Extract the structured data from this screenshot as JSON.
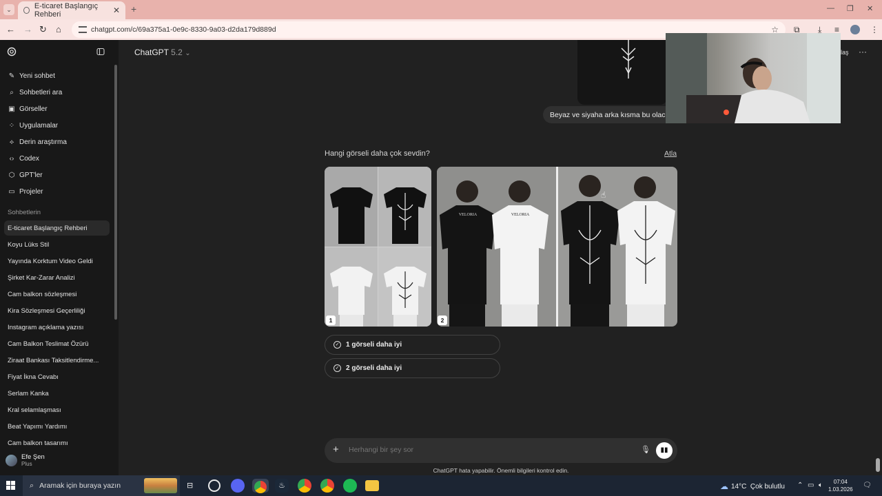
{
  "browser": {
    "tab_title": "E-ticaret Başlangıç Rehberi",
    "tab_close": "✕",
    "new_tab": "+",
    "url": "chatgpt.com/c/69a375a1-0e9c-8330-9a03-d2da179d889d"
  },
  "sidebar": {
    "nav": [
      {
        "label": "Yeni sohbet",
        "icon": "edit-icon"
      },
      {
        "label": "Sohbetleri ara",
        "icon": "search-icon"
      },
      {
        "label": "Görseller",
        "icon": "image-icon"
      },
      {
        "label": "Uygulamalar",
        "icon": "apps-icon"
      },
      {
        "label": "Derin araştırma",
        "icon": "telescope-icon"
      },
      {
        "label": "Codex",
        "icon": "code-icon"
      },
      {
        "label": "GPT'ler",
        "icon": "cube-icon"
      },
      {
        "label": "Projeler",
        "icon": "folder-icon"
      }
    ],
    "section_title": "Sohbetlerin",
    "chats": [
      "E-ticaret Başlangıç Rehberi",
      "Koyu Lüks Stil",
      "Yayında Korktum Video Geldi",
      "Şirket Kar-Zarar Analizi",
      "Cam balkon sözleşmesi",
      "Kira Sözleşmesi Geçerliliği",
      "Instagram açıklama yazısı",
      "Cam Balkon Teslimat Özürü",
      "Ziraat Bankası Taksitlendirme...",
      "Fiyat İkna Cevabı",
      "Serlam Kanka",
      "Kral selamlaşması",
      "Beat Yapımı Yardımı",
      "Cam balkon tasarımı"
    ],
    "active_chat_index": 0,
    "user": {
      "name": "Efe Şen",
      "plan": "Plus"
    }
  },
  "header": {
    "model_name": "ChatGPT",
    "model_version": "5.2",
    "share_partial": "laş"
  },
  "conversation": {
    "user_message": "Beyaz ve siyaha arka kısma bu olaca",
    "question": "Hangi görseli daha çok sevdin?",
    "skip_label": "Atla",
    "image_badges": [
      "1",
      "2"
    ],
    "shirt_brand": "VELORIA",
    "choices": [
      "1 görseli daha iyi",
      "2 görseli daha iyi"
    ]
  },
  "composer": {
    "placeholder": "Herhangi bir şey sor",
    "disclaimer": "ChatGPT hata yapabilir. Önemli bilgileri kontrol edin."
  },
  "taskbar": {
    "search_placeholder": "Aramak için buraya yazın",
    "weather_temp": "14°C",
    "weather_desc": "Çok bulutlu",
    "time": "07:04",
    "date": "1.03.2026"
  },
  "colors": {
    "page_bg": "#212121",
    "sidebar_bg": "#181818",
    "tab_bar": "#e8b2ac",
    "taskbar": "#1c2533"
  }
}
